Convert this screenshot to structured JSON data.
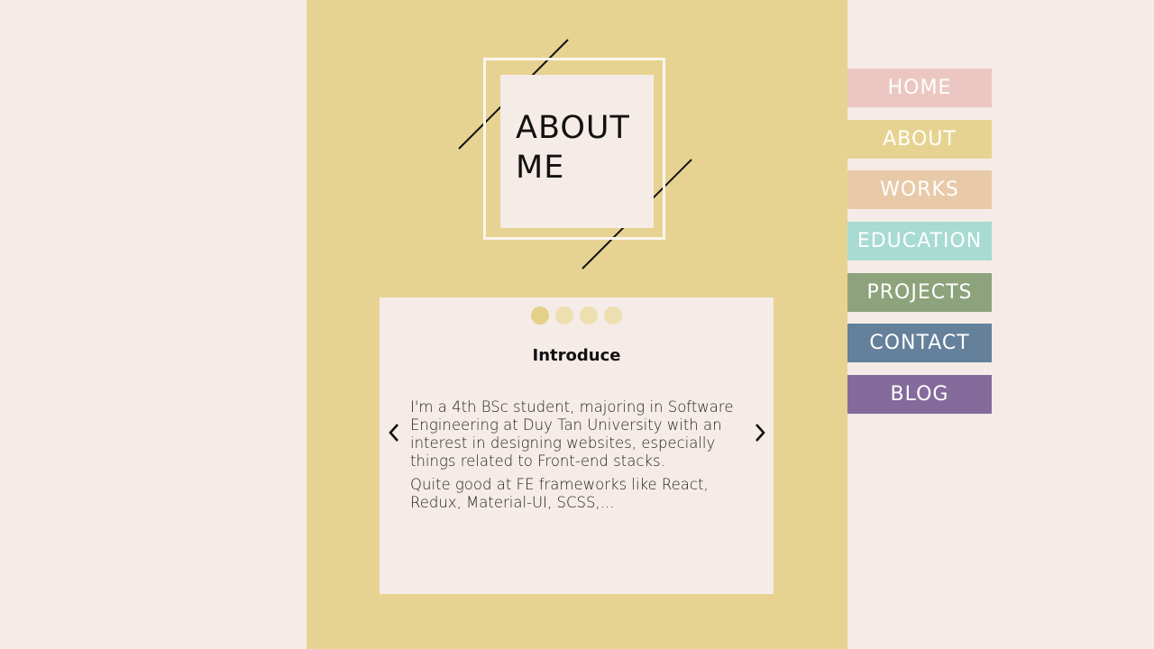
{
  "about": {
    "title_line1": "ABOUT",
    "title_line2": "ME"
  },
  "card": {
    "slide_count": 4,
    "active_slide": 1,
    "title": "Introduce",
    "paragraphs": [
      "I'm a 4th BSc student, majoring in Software Engineering at Duy Tan University with an interest in designing websites, especially things related to Front-end stacks.",
      "Quite good at FE frameworks like React, Redux, Material-UI, SCSS,..."
    ],
    "prev_icon": "chevron-left-icon",
    "next_icon": "chevron-right-icon"
  },
  "nav": {
    "items": [
      {
        "label": "HOME",
        "color": "#ecc7c1"
      },
      {
        "label": "ABOUT",
        "color": "#e7d391"
      },
      {
        "label": "WORKS",
        "color": "#e8caa9"
      },
      {
        "label": "EDUCATION",
        "color": "#a8dbd2"
      },
      {
        "label": "PROJECTS",
        "color": "#8da37c"
      },
      {
        "label": "CONTACT",
        "color": "#64809b"
      },
      {
        "label": "BLOG",
        "color": "#846b9b"
      }
    ]
  },
  "colors": {
    "background": "#f5ebe7",
    "panel": "#e7d391",
    "dot_active": "#e5d08a",
    "dot_inactive": "#eddfb0"
  }
}
